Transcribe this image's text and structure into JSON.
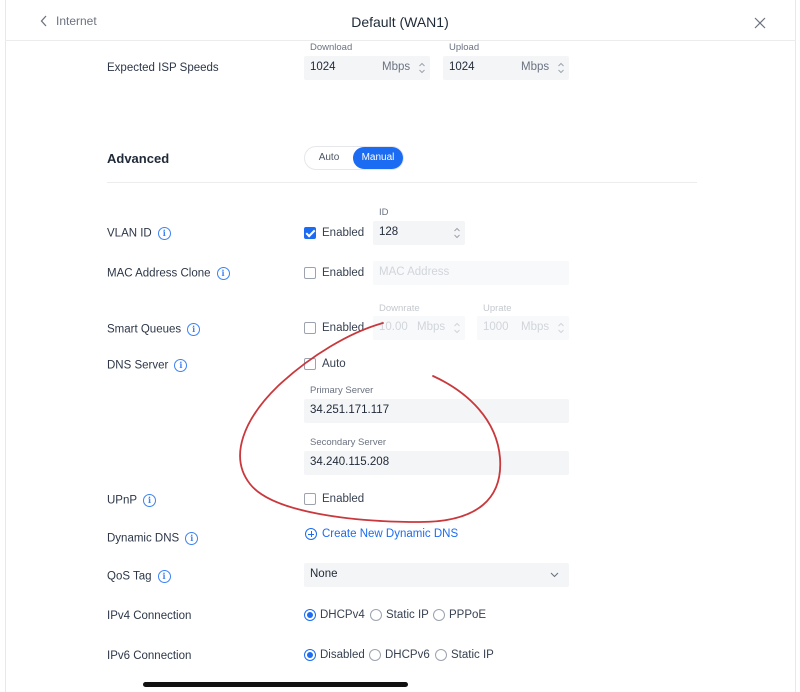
{
  "header": {
    "back_label": "Internet",
    "title": "Default (WAN1)"
  },
  "isp_speeds": {
    "label": "Expected ISP Speeds",
    "download_caption": "Download",
    "download_value": "1024",
    "download_unit": "Mbps",
    "upload_caption": "Upload",
    "upload_value": "1024",
    "upload_unit": "Mbps"
  },
  "advanced": {
    "label": "Advanced",
    "options": [
      "Auto",
      "Manual"
    ],
    "selected": "Manual"
  },
  "vlan": {
    "label": "VLAN ID",
    "enabled_label": "Enabled",
    "enabled": true,
    "id_caption": "ID",
    "id_value": "128"
  },
  "mac_clone": {
    "label": "MAC Address Clone",
    "enabled_label": "Enabled",
    "enabled": false,
    "placeholder": "MAC Address"
  },
  "smart_queues": {
    "label": "Smart Queues",
    "enabled_label": "Enabled",
    "enabled": false,
    "downrate_caption": "Downrate",
    "downrate_value": "10.00",
    "downrate_unit": "Mbps",
    "uprate_caption": "Uprate",
    "uprate_value": "1000",
    "uprate_unit": "Mbps"
  },
  "dns": {
    "label": "DNS Server",
    "auto_label": "Auto",
    "auto": false,
    "primary_caption": "Primary Server",
    "primary_value": "34.251.171.117",
    "secondary_caption": "Secondary Server",
    "secondary_value": "34.240.115.208"
  },
  "upnp": {
    "label": "UPnP",
    "enabled_label": "Enabled",
    "enabled": false
  },
  "ddns": {
    "label": "Dynamic DNS",
    "link_label": "Create New Dynamic DNS"
  },
  "qos": {
    "label": "QoS Tag",
    "value": "None"
  },
  "ipv4": {
    "label": "IPv4 Connection",
    "options": [
      "DHCPv4",
      "Static IP",
      "PPPoE"
    ],
    "selected": "DHCPv4"
  },
  "ipv6": {
    "label": "IPv6 Connection",
    "options": [
      "Disabled",
      "DHCPv6",
      "Static IP"
    ],
    "selected": "Disabled"
  },
  "colors": {
    "accent": "#1b6cf2",
    "annotation": "#c9383c"
  }
}
